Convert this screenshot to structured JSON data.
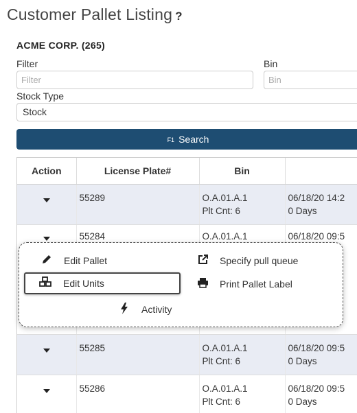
{
  "page": {
    "title": "Customer Pallet Listing",
    "help": "?"
  },
  "customer": "ACME CORP. (265)",
  "filters": {
    "filter_label": "Filter",
    "filter_placeholder": "Filter",
    "bin_label": "Bin",
    "bin_placeholder": "Bin",
    "stock_type_label": "Stock Type",
    "stock_type_value": "Stock"
  },
  "search": {
    "key": "F1",
    "label": "Search"
  },
  "table": {
    "headers": [
      "Action",
      "License Plate#",
      "Bin",
      ""
    ],
    "rows": [
      {
        "plate": "55289",
        "bin": "O.A.01.A.1",
        "plt": "Plt Cnt: 6",
        "date": "06/18/20 14:2",
        "days": "0 Days"
      },
      {
        "plate": "55284",
        "bin": "O.A.01.A.1",
        "plt": "",
        "date": "06/18/20 09:5",
        "days": ""
      },
      {
        "plate": "55285",
        "bin": "O.A.01.A.1",
        "plt": "Plt Cnt: 6",
        "date": "06/18/20 09:5",
        "days": "0 Days"
      },
      {
        "plate": "55286",
        "bin": "O.A.01.A.1",
        "plt": "Plt Cnt: 6",
        "date": "06/18/20 09:5",
        "days": "0 Days"
      }
    ]
  },
  "menu": {
    "edit_pallet": "Edit Pallet",
    "specify_pull_queue": "Specify pull queue",
    "edit_units": "Edit Units",
    "print_pallet_label": "Print Pallet Label",
    "activity": "Activity"
  },
  "colors": {
    "primary": "#1e4d72",
    "row_alt": "#e9ecf4"
  }
}
